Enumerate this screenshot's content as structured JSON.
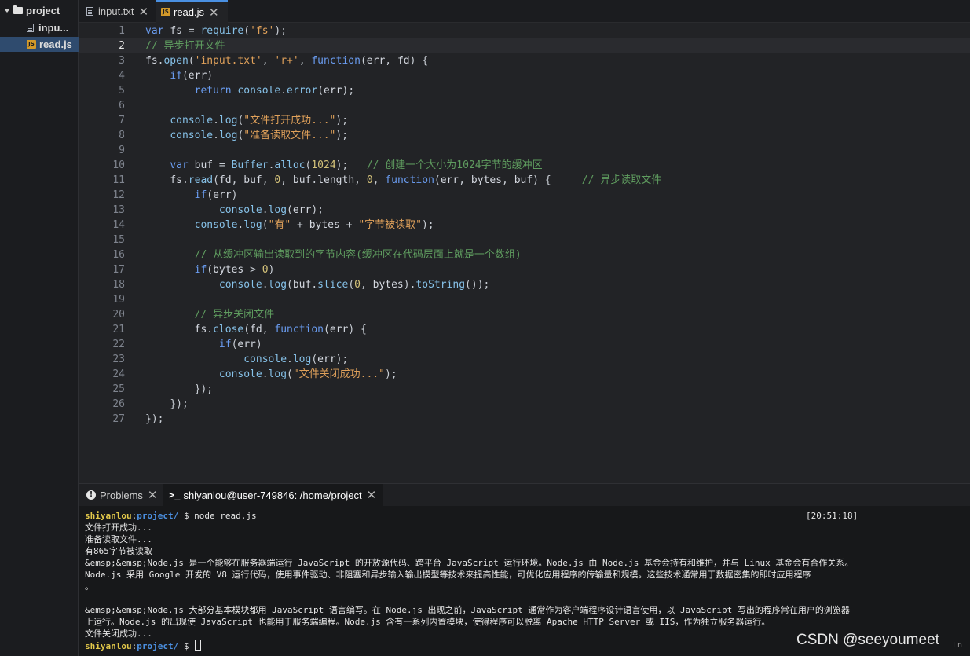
{
  "explorer": {
    "root": "project",
    "files": [
      "inpu...",
      "read.js"
    ],
    "active_file": "read.js"
  },
  "editor": {
    "tabs": [
      {
        "label": "input.txt",
        "icon": "text-file-icon"
      },
      {
        "label": "read.js",
        "icon": "js-file-icon"
      }
    ],
    "active_tab": "read.js",
    "current_line": 2,
    "lines": [
      [
        [
          "k",
          "var"
        ],
        [
          "p",
          " "
        ],
        [
          "v",
          "fs"
        ],
        [
          "p",
          " = "
        ],
        [
          "f",
          "require"
        ],
        [
          "p",
          "("
        ],
        [
          "s",
          "'fs'"
        ],
        [
          "p",
          ");"
        ]
      ],
      [
        [
          "c",
          "// 异步打开文件"
        ]
      ],
      [
        [
          "v",
          "fs"
        ],
        [
          "p",
          "."
        ],
        [
          "f",
          "open"
        ],
        [
          "p",
          "("
        ],
        [
          "s",
          "'input.txt'"
        ],
        [
          "p",
          ", "
        ],
        [
          "s",
          "'r+'"
        ],
        [
          "p",
          ", "
        ],
        [
          "k",
          "function"
        ],
        [
          "p",
          "("
        ],
        [
          "v",
          "err"
        ],
        [
          "p",
          ", "
        ],
        [
          "v",
          "fd"
        ],
        [
          "p",
          ") {"
        ]
      ],
      [
        [
          "p",
          "    "
        ],
        [
          "k",
          "if"
        ],
        [
          "p",
          "("
        ],
        [
          "v",
          "err"
        ],
        [
          "p",
          ")"
        ]
      ],
      [
        [
          "p",
          "        "
        ],
        [
          "k",
          "return"
        ],
        [
          "p",
          " "
        ],
        [
          "f",
          "console"
        ],
        [
          "p",
          "."
        ],
        [
          "f",
          "error"
        ],
        [
          "p",
          "("
        ],
        [
          "v",
          "err"
        ],
        [
          "p",
          ");"
        ]
      ],
      [],
      [
        [
          "p",
          "    "
        ],
        [
          "f",
          "console"
        ],
        [
          "p",
          "."
        ],
        [
          "f",
          "log"
        ],
        [
          "p",
          "("
        ],
        [
          "s",
          "\"文件打开成功...\""
        ],
        [
          "p",
          ");"
        ]
      ],
      [
        [
          "p",
          "    "
        ],
        [
          "f",
          "console"
        ],
        [
          "p",
          "."
        ],
        [
          "f",
          "log"
        ],
        [
          "p",
          "("
        ],
        [
          "s",
          "\"准备读取文件...\""
        ],
        [
          "p",
          ");"
        ]
      ],
      [],
      [
        [
          "p",
          "    "
        ],
        [
          "k",
          "var"
        ],
        [
          "p",
          " "
        ],
        [
          "v",
          "buf"
        ],
        [
          "p",
          " = "
        ],
        [
          "f",
          "Buffer"
        ],
        [
          "p",
          "."
        ],
        [
          "f",
          "alloc"
        ],
        [
          "p",
          "("
        ],
        [
          "n",
          "1024"
        ],
        [
          "p",
          ");   "
        ],
        [
          "c",
          "// 创建一个大小为1024字节的缓冲区"
        ]
      ],
      [
        [
          "p",
          "    "
        ],
        [
          "v",
          "fs"
        ],
        [
          "p",
          "."
        ],
        [
          "f",
          "read"
        ],
        [
          "p",
          "("
        ],
        [
          "v",
          "fd"
        ],
        [
          "p",
          ", "
        ],
        [
          "v",
          "buf"
        ],
        [
          "p",
          ", "
        ],
        [
          "n",
          "0"
        ],
        [
          "p",
          ", "
        ],
        [
          "v",
          "buf"
        ],
        [
          "p",
          "."
        ],
        [
          "v",
          "length"
        ],
        [
          "p",
          ", "
        ],
        [
          "n",
          "0"
        ],
        [
          "p",
          ", "
        ],
        [
          "k",
          "function"
        ],
        [
          "p",
          "("
        ],
        [
          "v",
          "err"
        ],
        [
          "p",
          ", "
        ],
        [
          "v",
          "bytes"
        ],
        [
          "p",
          ", "
        ],
        [
          "v",
          "buf"
        ],
        [
          "p",
          ") {     "
        ],
        [
          "c",
          "// 异步读取文件"
        ]
      ],
      [
        [
          "p",
          "        "
        ],
        [
          "k",
          "if"
        ],
        [
          "p",
          "("
        ],
        [
          "v",
          "err"
        ],
        [
          "p",
          ")"
        ]
      ],
      [
        [
          "p",
          "            "
        ],
        [
          "f",
          "console"
        ],
        [
          "p",
          "."
        ],
        [
          "f",
          "log"
        ],
        [
          "p",
          "("
        ],
        [
          "v",
          "err"
        ],
        [
          "p",
          ");"
        ]
      ],
      [
        [
          "p",
          "        "
        ],
        [
          "f",
          "console"
        ],
        [
          "p",
          "."
        ],
        [
          "f",
          "log"
        ],
        [
          "p",
          "("
        ],
        [
          "s",
          "\"有\""
        ],
        [
          "p",
          " + "
        ],
        [
          "v",
          "bytes"
        ],
        [
          "p",
          " + "
        ],
        [
          "s",
          "\"字节被读取\""
        ],
        [
          "p",
          ");"
        ]
      ],
      [],
      [
        [
          "p",
          "        "
        ],
        [
          "c",
          "// 从缓冲区输出读取到的字节内容(缓冲区在代码层面上就是一个数组)"
        ]
      ],
      [
        [
          "p",
          "        "
        ],
        [
          "k",
          "if"
        ],
        [
          "p",
          "("
        ],
        [
          "v",
          "bytes"
        ],
        [
          "p",
          " > "
        ],
        [
          "n",
          "0"
        ],
        [
          "p",
          ")"
        ]
      ],
      [
        [
          "p",
          "            "
        ],
        [
          "f",
          "console"
        ],
        [
          "p",
          "."
        ],
        [
          "f",
          "log"
        ],
        [
          "p",
          "("
        ],
        [
          "v",
          "buf"
        ],
        [
          "p",
          "."
        ],
        [
          "f",
          "slice"
        ],
        [
          "p",
          "("
        ],
        [
          "n",
          "0"
        ],
        [
          "p",
          ", "
        ],
        [
          "v",
          "bytes"
        ],
        [
          "p",
          ")."
        ],
        [
          "f",
          "toString"
        ],
        [
          "p",
          "());"
        ]
      ],
      [],
      [
        [
          "p",
          "        "
        ],
        [
          "c",
          "// 异步关闭文件"
        ]
      ],
      [
        [
          "p",
          "        "
        ],
        [
          "v",
          "fs"
        ],
        [
          "p",
          "."
        ],
        [
          "f",
          "close"
        ],
        [
          "p",
          "("
        ],
        [
          "v",
          "fd"
        ],
        [
          "p",
          ", "
        ],
        [
          "k",
          "function"
        ],
        [
          "p",
          "("
        ],
        [
          "v",
          "err"
        ],
        [
          "p",
          ") {"
        ]
      ],
      [
        [
          "p",
          "            "
        ],
        [
          "k",
          "if"
        ],
        [
          "p",
          "("
        ],
        [
          "v",
          "err"
        ],
        [
          "p",
          ")"
        ]
      ],
      [
        [
          "p",
          "                "
        ],
        [
          "f",
          "console"
        ],
        [
          "p",
          "."
        ],
        [
          "f",
          "log"
        ],
        [
          "p",
          "("
        ],
        [
          "v",
          "err"
        ],
        [
          "p",
          ");"
        ]
      ],
      [
        [
          "p",
          "            "
        ],
        [
          "f",
          "console"
        ],
        [
          "p",
          "."
        ],
        [
          "f",
          "log"
        ],
        [
          "p",
          "("
        ],
        [
          "s",
          "\"文件关闭成功...\""
        ],
        [
          "p",
          ");"
        ]
      ],
      [
        [
          "p",
          "        "
        ],
        [
          "p",
          "});"
        ]
      ],
      [
        [
          "p",
          "    "
        ],
        [
          "p",
          "});"
        ]
      ],
      [
        [
          "p",
          "});"
        ]
      ]
    ]
  },
  "panel": {
    "problems_label": "Problems",
    "terminal_label": "shiyanlou@user-749846: /home/project",
    "terminal": {
      "timestamp": "[20:51:18]",
      "prompt_user": "shiyanlou",
      "prompt_sep": ":",
      "prompt_path": "project/",
      "prompt_dollar": " $ ",
      "command": "node read.js",
      "output": [
        "文件打开成功...",
        "准备读取文件...",
        "有865字节被读取",
        "&emsp;&emsp;Node.js 是一个能够在服务器端运行 JavaScript 的开放源代码、跨平台 JavaScript 运行环境。Node.js 由 Node.js 基金会持有和维护，并与 Linux 基金会有合作关系。",
        "Node.js 采用 Google 开发的 V8 运行代码，使用事件驱动、非阻塞和异步输入输出模型等技术来提高性能，可优化应用程序的传输量和规模。这些技术通常用于数据密集的即时应用程序",
        "。",
        "",
        "&emsp;&emsp;Node.js 大部分基本模块都用 JavaScript 语言编写。在 Node.js 出现之前，JavaScript 通常作为客户端程序设计语言使用，以 JavaScript 写出的程序常在用户的浏览器",
        "上运行。Node.js 的出现使 JavaScript 也能用于服务端编程。Node.js 含有一系列内置模块，使得程序可以脱离 Apache HTTP Server 或 IIS，作为独立服务器运行。",
        "文件关闭成功..."
      ]
    }
  },
  "watermark": "CSDN @seeyoumeet",
  "corner_text": "Ln",
  "colors": {
    "keyword": "#6a9cf0",
    "string": "#e0a15a",
    "comment": "#5f9c5f",
    "number": "#d4c27a",
    "prompt_user": "#e2c84a",
    "prompt_path": "#4b8fe0"
  }
}
